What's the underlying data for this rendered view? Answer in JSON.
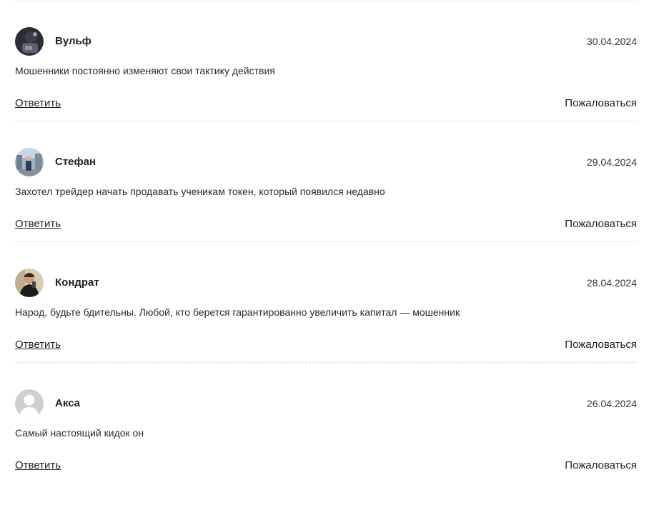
{
  "comments": [
    {
      "author": "Вульф",
      "date": "30.04.2024",
      "text": "Мошенники постоянно изменяют свои тактику действия",
      "avatar": "photo-avatar"
    },
    {
      "author": "Стефан",
      "date": "29.04.2024",
      "text": "Захотел трейдер начать продавать ученикам токен, который появился недавно",
      "avatar": "photo-avatar"
    },
    {
      "author": "Кондрат",
      "date": "28.04.2024",
      "text": "Народ, будьте бдительны. Любой, кто берется гарантированно увеличить капитал — мошенник",
      "avatar": "photo-avatar"
    },
    {
      "author": "Акса",
      "date": "26.04.2024",
      "text": "Самый настоящий кидок он",
      "avatar": "default-user-icon"
    }
  ],
  "actions": {
    "reply_label": "Ответить",
    "report_label": "Пожаловаться"
  },
  "colors": {
    "text": "#222222",
    "divider": "#dedede",
    "default_avatar_bg": "#cfcfcf"
  }
}
